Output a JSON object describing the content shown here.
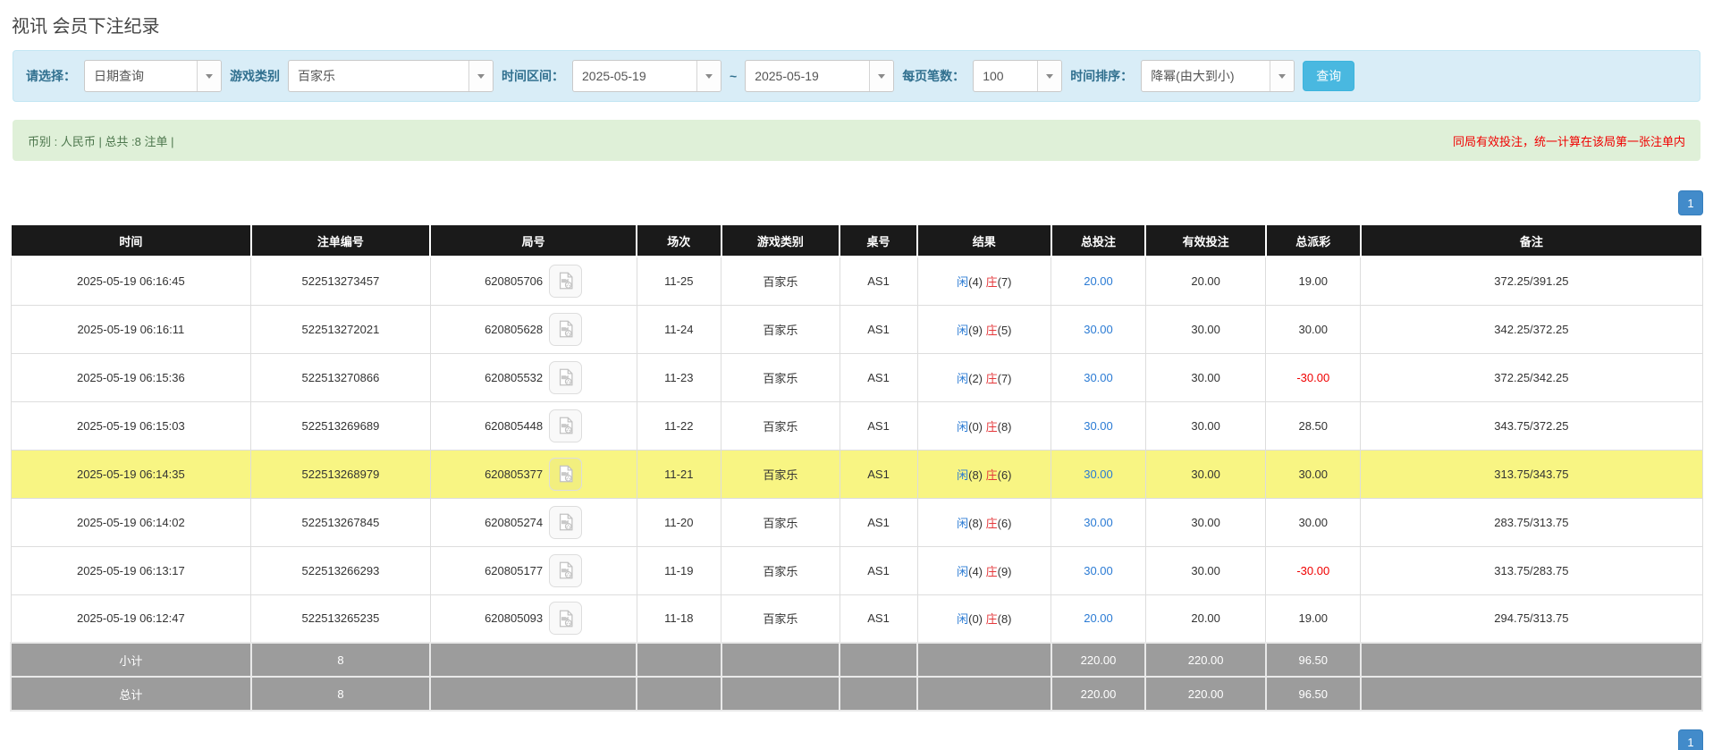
{
  "page": {
    "title": "视讯 会员下注纪录"
  },
  "filter": {
    "select_label": "请选择：",
    "select_value": "日期查询",
    "game_label": "游戏类别",
    "game_value": "百家乐",
    "range_label": "时间区间：",
    "date_from": "2025-05-19",
    "range_separator": "~",
    "date_to": "2025-05-19",
    "per_page_label": "每页笔数：",
    "per_page_value": "100",
    "sort_label": "时间排序：",
    "sort_value": "降幂(由大到小)",
    "search_button": "查询"
  },
  "summary": {
    "info": "币别 : 人民币 | 总共 :8 注单 |",
    "notice": "同局有效投注，统一计算在该局第一张注单内"
  },
  "pagination": {
    "top": "1",
    "bottom": "1"
  },
  "colors": {
    "accent_blue": "#49b8e0",
    "link_blue": "#2b7bd4",
    "banker_red": "#e4393c",
    "negative_red": "#f00000",
    "highlight_yellow": "#f8f583"
  },
  "table": {
    "headers": [
      "时间",
      "注单编号",
      "局号",
      "场次",
      "游戏类别",
      "桌号",
      "结果",
      "总投注",
      "有效投注",
      "总派彩",
      "备注"
    ],
    "result_player_label": "闲",
    "result_banker_label": "庄",
    "rows": [
      {
        "time": "2025-05-19 06:16:45",
        "bet_no": "522513273457",
        "round_no": "620805706",
        "session": "11-25",
        "game": "百家乐",
        "table_no": "AS1",
        "player": "(4)",
        "banker": "(7)",
        "total_bet": "20.00",
        "valid_bet": "20.00",
        "payout": "19.00",
        "payout_negative": false,
        "remark": "372.25/391.25",
        "highlighted": false
      },
      {
        "time": "2025-05-19 06:16:11",
        "bet_no": "522513272021",
        "round_no": "620805628",
        "session": "11-24",
        "game": "百家乐",
        "table_no": "AS1",
        "player": "(9)",
        "banker": "(5)",
        "total_bet": "30.00",
        "valid_bet": "30.00",
        "payout": "30.00",
        "payout_negative": false,
        "remark": "342.25/372.25",
        "highlighted": false
      },
      {
        "time": "2025-05-19 06:15:36",
        "bet_no": "522513270866",
        "round_no": "620805532",
        "session": "11-23",
        "game": "百家乐",
        "table_no": "AS1",
        "player": "(2)",
        "banker": "(7)",
        "total_bet": "30.00",
        "valid_bet": "30.00",
        "payout": "-30.00",
        "payout_negative": true,
        "remark": "372.25/342.25",
        "highlighted": false
      },
      {
        "time": "2025-05-19 06:15:03",
        "bet_no": "522513269689",
        "round_no": "620805448",
        "session": "11-22",
        "game": "百家乐",
        "table_no": "AS1",
        "player": "(0)",
        "banker": "(8)",
        "total_bet": "30.00",
        "valid_bet": "30.00",
        "payout": "28.50",
        "payout_negative": false,
        "remark": "343.75/372.25",
        "highlighted": false
      },
      {
        "time": "2025-05-19 06:14:35",
        "bet_no": "522513268979",
        "round_no": "620805377",
        "session": "11-21",
        "game": "百家乐",
        "table_no": "AS1",
        "player": "(8)",
        "banker": "(6)",
        "total_bet": "30.00",
        "valid_bet": "30.00",
        "payout": "30.00",
        "payout_negative": false,
        "remark": "313.75/343.75",
        "highlighted": true
      },
      {
        "time": "2025-05-19 06:14:02",
        "bet_no": "522513267845",
        "round_no": "620805274",
        "session": "11-20",
        "game": "百家乐",
        "table_no": "AS1",
        "player": "(8)",
        "banker": "(6)",
        "total_bet": "30.00",
        "valid_bet": "30.00",
        "payout": "30.00",
        "payout_negative": false,
        "remark": "283.75/313.75",
        "highlighted": false
      },
      {
        "time": "2025-05-19 06:13:17",
        "bet_no": "522513266293",
        "round_no": "620805177",
        "session": "11-19",
        "game": "百家乐",
        "table_no": "AS1",
        "player": "(4)",
        "banker": "(9)",
        "total_bet": "30.00",
        "valid_bet": "30.00",
        "payout": "-30.00",
        "payout_negative": true,
        "remark": "313.75/283.75",
        "highlighted": false
      },
      {
        "time": "2025-05-19 06:12:47",
        "bet_no": "522513265235",
        "round_no": "620805093",
        "session": "11-18",
        "game": "百家乐",
        "table_no": "AS1",
        "player": "(0)",
        "banker": "(8)",
        "total_bet": "20.00",
        "valid_bet": "20.00",
        "payout": "19.00",
        "payout_negative": false,
        "remark": "294.75/313.75",
        "highlighted": false
      }
    ],
    "footers": [
      {
        "label": "小计",
        "count": "8",
        "total_bet": "220.00",
        "valid_bet": "220.00",
        "payout": "96.50"
      },
      {
        "label": "总计",
        "count": "8",
        "total_bet": "220.00",
        "valid_bet": "220.00",
        "payout": "96.50"
      }
    ]
  }
}
